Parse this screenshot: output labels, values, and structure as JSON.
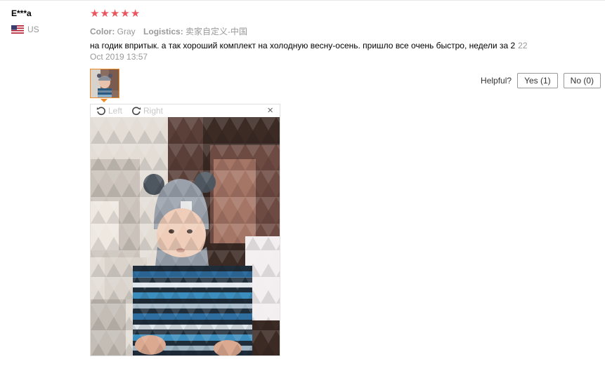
{
  "buyer": {
    "name": "E***a",
    "country": "US"
  },
  "rating": {
    "stars": 5,
    "max": 5,
    "color": "#e9565e"
  },
  "attributes": [
    {
      "label": "Color:",
      "value": "Gray"
    },
    {
      "label": "Logistics:",
      "value": "卖家自定义-中国"
    }
  ],
  "review": {
    "text": "на годик впритык. а так хороший комплект на холодную весну-осень. пришло все очень быстро, недели за 2",
    "extra": "22",
    "date": "Oct 2019 13:57"
  },
  "helpful": {
    "label": "Helpful?",
    "yes_label": "Yes (1)",
    "no_label": "No (0)"
  },
  "viewer": {
    "rotate_left": "Left",
    "rotate_right": "Right",
    "close": "×"
  },
  "icons": [
    "us-flag-icon",
    "star-icon",
    "rotate-left-icon",
    "rotate-right-icon",
    "close-icon"
  ],
  "colors": {
    "accent": "#f08a24",
    "star": "#e9565e",
    "muted": "#999999"
  }
}
